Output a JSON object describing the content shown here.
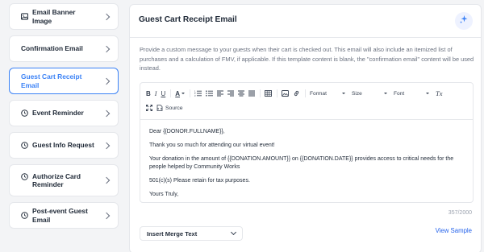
{
  "sidebar": {
    "items": [
      {
        "label": "Email Banner Image",
        "icon": "image-icon",
        "active": false
      },
      {
        "label": "Confirmation Email",
        "icon": "",
        "active": false
      },
      {
        "label": "Guest Cart Receipt Email",
        "icon": "",
        "active": true
      },
      {
        "label": "Event Reminder",
        "icon": "clock-icon",
        "active": false
      },
      {
        "label": "Guest Info Request",
        "icon": "clock-icon",
        "active": false
      },
      {
        "label": "Authorize Card Reminder",
        "icon": "clock-icon",
        "active": false
      },
      {
        "label": "Post-event Guest Email",
        "icon": "clock-icon",
        "active": false
      }
    ]
  },
  "main": {
    "title": "Guest Cart Receipt Email",
    "description": "Provide a custom message to your guests when their cart is checked out. This email will also include an itemized list of purchases and a calculation of FMV, if applicable. If this template content is blank, the \"confirmation email\" content will be used instead.",
    "toolbar": {
      "bold": "B",
      "italic": "I",
      "underline": "U",
      "font_color": "A",
      "format_label": "Format",
      "size_label": "Size",
      "font_label": "Font",
      "clear_format": "Tx",
      "source_label": "Source"
    },
    "content": [
      "Dear {{DONOR.FULLNAME}},",
      "Thank you so much for attending our virtual event!",
      "Your donation in the amount of {{DONATION.AMOUNT}} on {{DONATION.DATE}} provides access to critical needs for the people helped by Community Works",
      "501(c)(s) Please retain for tax purposes.",
      "Yours Truly,"
    ],
    "counter": "357/2000",
    "merge_text_label": "Insert Merge Text",
    "view_sample_label": "View Sample"
  },
  "colors": {
    "accent": "#3b82f6",
    "link": "#2563eb",
    "border": "#e5e7eb"
  }
}
